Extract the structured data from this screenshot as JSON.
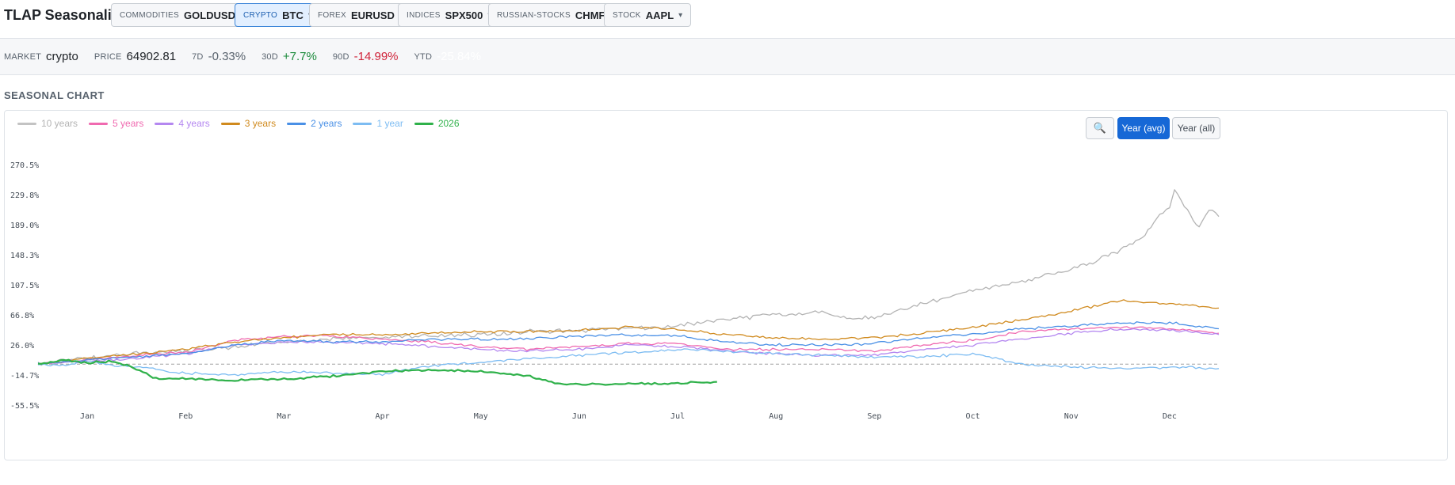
{
  "app": {
    "title": "TLAP Seasonality"
  },
  "pickers": [
    {
      "category": "COMMODITIES",
      "value": "GOLDUSD",
      "active": false
    },
    {
      "category": "CRYPTO",
      "value": "BTC",
      "active": true
    },
    {
      "category": "FOREX",
      "value": "EURUSD",
      "active": false
    },
    {
      "category": "INDICES",
      "value": "SPX500",
      "active": false
    },
    {
      "category": "RUSSIAN-STOCKS",
      "value": "CHMF",
      "active": false
    },
    {
      "category": "STOCK",
      "value": "AAPL",
      "active": false
    }
  ],
  "caret": "▾",
  "stats": {
    "market_label": "MARKET",
    "market": "crypto",
    "price_label": "PRICE",
    "price": "64902.81",
    "d7_label": "7D",
    "d7": "-0.33%",
    "d30_label": "30D",
    "d30": "+7.7%",
    "d90_label": "90D",
    "d90": "-14.99%",
    "ytd_label": "YTD",
    "ytd": "-25.84%"
  },
  "section": {
    "title": "SEASONAL CHART"
  },
  "controls": {
    "zoom_icon": "🔍",
    "year_avg": "Year (avg)",
    "year_all": "Year (all)"
  },
  "colors": {
    "10y": "#b4b4b4",
    "5y": "#f06ab0",
    "4y": "#b487f0",
    "3y": "#d08a1e",
    "2y": "#4a90e6",
    "1y": "#7dbcf2",
    "2026": "#2fb14a",
    "zero": "#a0a0a0"
  },
  "chart_data": {
    "type": "line",
    "title": "",
    "xlabel": "",
    "ylabel": "",
    "y_unit": "%",
    "ylim": [
      -55.5,
      270.5
    ],
    "yticks": [
      "270.5%",
      "229.8%",
      "189.0%",
      "148.3%",
      "107.5%",
      "66.8%",
      "26.0%",
      "-14.7%",
      "-55.5%"
    ],
    "ytick_values": [
      270.5,
      229.8,
      189.0,
      148.3,
      107.5,
      66.8,
      26.0,
      -14.7,
      -55.5
    ],
    "months": [
      "Jan",
      "Feb",
      "Mar",
      "Apr",
      "May",
      "Jun",
      "Jul",
      "Aug",
      "Sep",
      "Oct",
      "Nov",
      "Dec"
    ],
    "x_unit": "month index (0 = Jan 1, 12 = Dec 31)",
    "grid": false,
    "legend_position": "top-left",
    "series": [
      {
        "key": "10y",
        "name": "10 years",
        "legend_faded": true,
        "x": [
          0,
          0.5,
          1.0,
          1.5,
          2.0,
          2.5,
          3.0,
          3.5,
          4.0,
          4.5,
          5.0,
          5.5,
          6.0,
          6.5,
          7.0,
          7.5,
          8.0,
          8.25,
          8.5,
          9.0,
          9.5,
          10.0,
          10.5,
          10.75,
          11.0,
          11.25,
          11.4,
          11.5,
          11.55,
          11.65,
          11.8,
          11.9,
          12.0
        ],
        "y": [
          0,
          8,
          14,
          18,
          24,
          30,
          34,
          36,
          38,
          40,
          44,
          46,
          48,
          52,
          60,
          68,
          70,
          62,
          64,
          82,
          100,
          112,
          128,
          140,
          155,
          175,
          200,
          212,
          235,
          215,
          185,
          210,
          200
        ]
      },
      {
        "key": "5y",
        "name": "5 years",
        "legend_faded": false,
        "x": [
          0,
          0.5,
          1.0,
          1.5,
          2.0,
          2.5,
          3.0,
          3.5,
          4.0,
          4.5,
          5.0,
          5.5,
          6.0,
          6.5,
          7.0,
          7.5,
          8.0,
          8.5,
          9.0,
          9.5,
          10.0,
          10.5,
          11.0,
          11.5,
          12.0
        ],
        "y": [
          0,
          6,
          12,
          16,
          32,
          38,
          38,
          34,
          30,
          24,
          20,
          24,
          28,
          28,
          20,
          20,
          20,
          18,
          26,
          32,
          44,
          48,
          50,
          48,
          42
        ]
      },
      {
        "key": "4y",
        "name": "4 years",
        "legend_faded": false,
        "x": [
          0,
          0.5,
          1.0,
          1.5,
          2.0,
          2.5,
          3.0,
          3.5,
          4.0,
          4.5,
          5.0,
          5.5,
          6.0,
          6.5,
          7.0,
          7.5,
          8.0,
          8.5,
          9.0,
          9.5,
          10.0,
          10.5,
          11.0,
          11.5,
          12.0
        ],
        "y": [
          0,
          4,
          8,
          14,
          26,
          30,
          30,
          28,
          24,
          20,
          18,
          20,
          26,
          24,
          18,
          14,
          12,
          12,
          20,
          26,
          34,
          42,
          48,
          46,
          40
        ]
      },
      {
        "key": "3y",
        "name": "3 years",
        "legend_faded": false,
        "x": [
          0,
          0.5,
          1.0,
          1.5,
          2.0,
          2.5,
          3.0,
          3.5,
          4.0,
          4.5,
          5.0,
          5.5,
          6.0,
          6.5,
          7.0,
          7.5,
          8.0,
          8.5,
          9.0,
          9.5,
          10.0,
          10.5,
          11.0,
          11.5,
          12.0
        ],
        "y": [
          0,
          8,
          14,
          20,
          30,
          36,
          40,
          40,
          42,
          44,
          44,
          46,
          50,
          48,
          40,
          36,
          34,
          36,
          42,
          50,
          60,
          72,
          86,
          82,
          76
        ]
      },
      {
        "key": "2y",
        "name": "2 years",
        "legend_faded": false,
        "x": [
          0,
          0.5,
          1.0,
          1.5,
          2.0,
          2.5,
          3.0,
          3.5,
          4.0,
          4.5,
          5.0,
          5.5,
          6.0,
          6.5,
          7.0,
          7.5,
          8.0,
          8.5,
          9.0,
          9.5,
          10.0,
          10.5,
          11.0,
          11.5,
          12.0
        ],
        "y": [
          0,
          6,
          10,
          14,
          26,
          32,
          30,
          30,
          34,
          34,
          34,
          38,
          40,
          38,
          30,
          26,
          26,
          28,
          36,
          40,
          48,
          52,
          56,
          56,
          48
        ]
      },
      {
        "key": "1y",
        "name": "1 year",
        "legend_faded": false,
        "x": [
          0,
          0.25,
          0.5,
          0.75,
          1.0,
          1.5,
          2.0,
          2.5,
          3.0,
          3.5,
          4.0,
          4.5,
          5.0,
          5.5,
          6.0,
          6.5,
          7.0,
          7.5,
          8.0,
          8.5,
          9.0,
          9.5,
          10.0,
          10.5,
          11.0,
          11.5,
          12.0
        ],
        "y": [
          0,
          -2,
          4,
          -2,
          -4,
          -12,
          -14,
          -10,
          -12,
          -14,
          -2,
          2,
          8,
          12,
          16,
          20,
          18,
          14,
          12,
          10,
          10,
          14,
          0,
          -4,
          -6,
          -4,
          -6
        ]
      },
      {
        "key": "2026",
        "name": "2026",
        "legend_faded": false,
        "x": [
          0,
          0.25,
          0.5,
          0.75,
          0.9,
          1.0,
          1.2,
          1.5,
          2.0,
          2.5,
          3.0,
          3.5,
          4.0,
          4.5,
          5.0,
          5.25,
          5.5,
          6.0,
          6.5,
          6.9
        ],
        "y": [
          0,
          6,
          2,
          4,
          -2,
          -6,
          -20,
          -20,
          -22,
          -20,
          -16,
          -10,
          -8,
          -10,
          -16,
          -26,
          -28,
          -26,
          -26,
          -24
        ]
      }
    ]
  }
}
